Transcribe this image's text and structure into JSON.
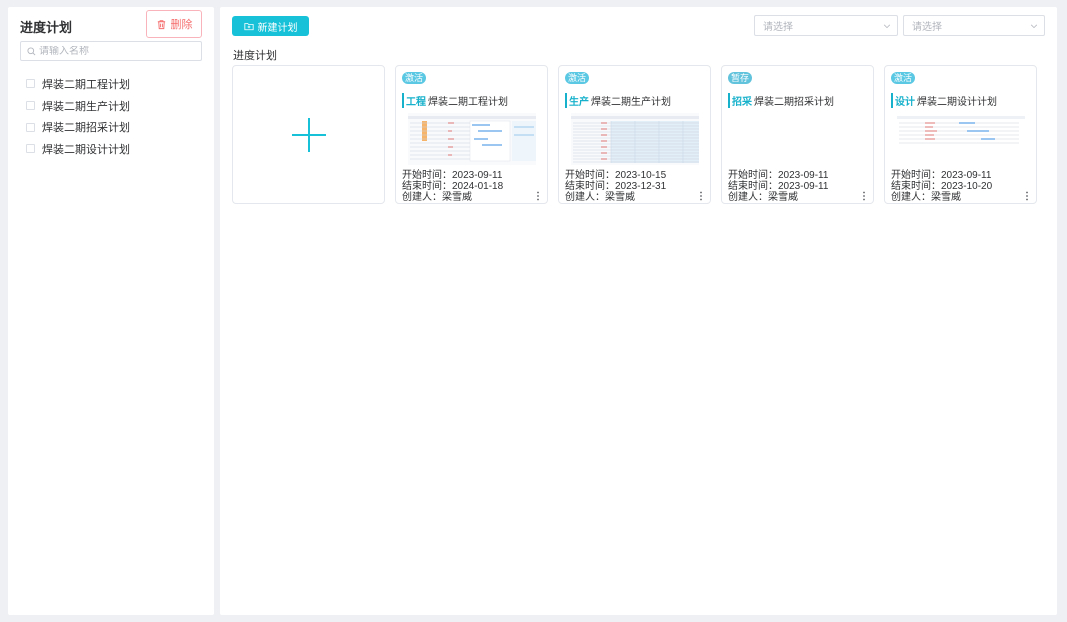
{
  "sidebar": {
    "title": "进度计划",
    "delete_label": "删除",
    "search_placeholder": "请输入名称",
    "items": [
      {
        "label": "焊装二期工程计划"
      },
      {
        "label": "焊装二期生产计划"
      },
      {
        "label": "焊装二期招采计划"
      },
      {
        "label": "焊装二期设计计划"
      }
    ]
  },
  "toolbar": {
    "new_plan_label": "新建计划",
    "select1_placeholder": "请选择",
    "select2_placeholder": "请选择"
  },
  "section_title": "进度计划",
  "cards": [
    {
      "status": "激活",
      "status_color": "#5ac8e3",
      "type": "工程",
      "name": "焊装二期工程计划",
      "start": "开始时间：2023-09-11",
      "end": "结束时间：2024-01-18",
      "creator": "创建人：梁雪威",
      "has_thumb": true
    },
    {
      "status": "激活",
      "status_color": "#5ac8e3",
      "type": "生产",
      "name": "焊装二期生产计划",
      "start": "开始时间：2023-10-15",
      "end": "结束时间：2023-12-31",
      "creator": "创建人：梁雪威",
      "has_thumb": true
    },
    {
      "status": "暂存",
      "status_color": "#62c3dc",
      "type": "招采",
      "name": "焊装二期招采计划",
      "start": "开始时间：2023-09-11",
      "end": "结束时间：2023-09-11",
      "creator": "创建人：梁雪威",
      "has_thumb": false
    },
    {
      "status": "激活",
      "status_color": "#5ac8e3",
      "type": "设计",
      "name": "焊装二期设计计划",
      "start": "开始时间：2023-09-11",
      "end": "结束时间：2023-10-20",
      "creator": "创建人：梁雪威",
      "has_thumb": true
    }
  ],
  "colors": {
    "accent": "#17c2d9",
    "danger": "#f56c6c"
  }
}
